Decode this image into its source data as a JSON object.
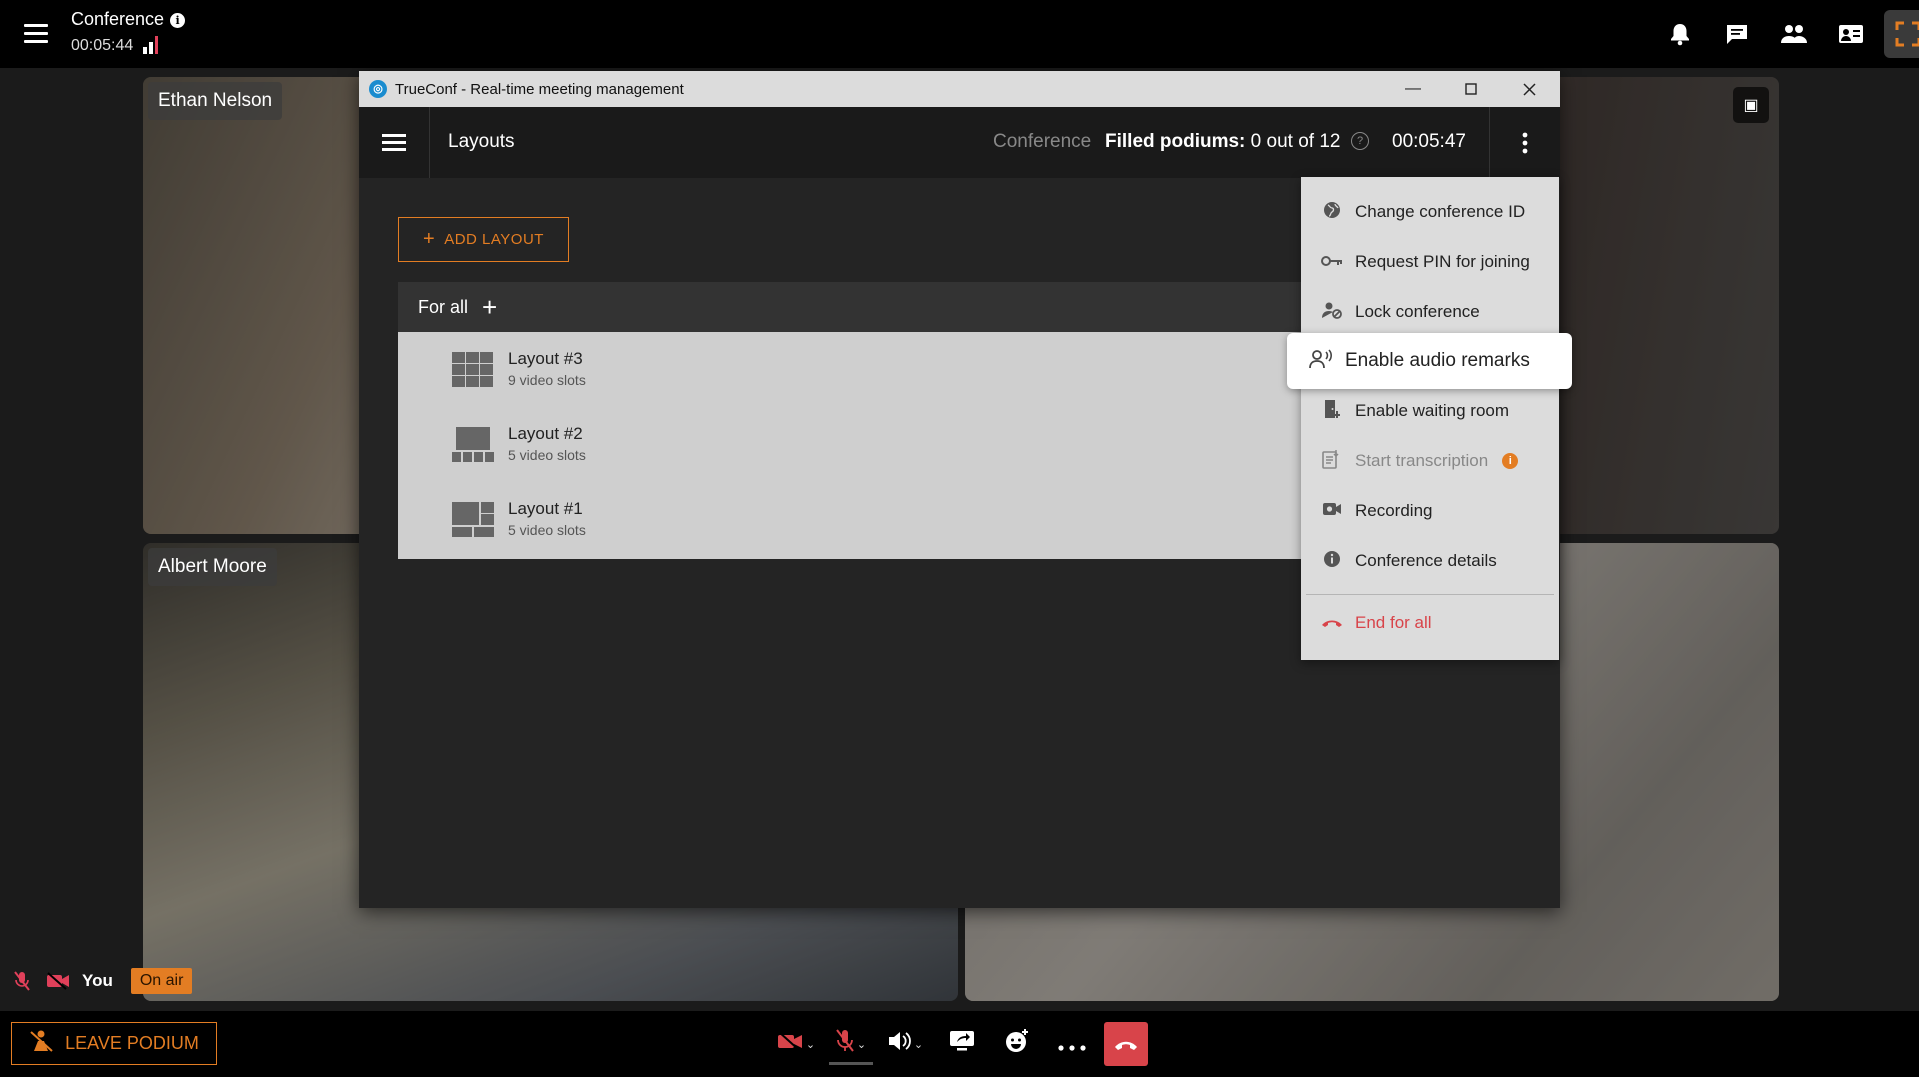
{
  "topbar": {
    "title": "Conference",
    "elapsed": "00:05:44",
    "icons": [
      "bell-icon",
      "chat-icon",
      "participants-icon",
      "slideshow-icon",
      "fullscreen-icon"
    ],
    "accent": "#e37d23"
  },
  "tiles": [
    {
      "name": "Ethan Nelson"
    },
    {
      "name": ""
    },
    {
      "name": "Albert Moore"
    },
    {
      "name": ""
    }
  ],
  "self": {
    "label": "You",
    "status": "On air"
  },
  "bottombar": {
    "leave_label": "LEAVE PODIUM",
    "controls": [
      "camera-off-icon",
      "mic-off-icon",
      "speaker-icon",
      "share-screen-icon",
      "reactions-icon",
      "more-icon",
      "hangup-icon"
    ]
  },
  "dialog": {
    "window_title": "TrueConf - Real-time meeting management",
    "page_title": "Layouts",
    "conference_label": "Conference",
    "podiums_label": "Filled podiums:",
    "podiums_value": "0 out of 12",
    "timer": "00:05:47",
    "add_layout_label": "ADD LAYOUT",
    "group_label": "For all",
    "layouts": [
      {
        "name": "Layout #3",
        "slots": "9 video slots"
      },
      {
        "name": "Layout #2",
        "slots": "5 video slots"
      },
      {
        "name": "Layout #1",
        "slots": "5 video slots"
      }
    ]
  },
  "menu": {
    "items": [
      {
        "label": "Change conference ID",
        "icon": "globe-icon"
      },
      {
        "label": "Request PIN for joining",
        "icon": "key-icon"
      },
      {
        "label": "Lock conference",
        "icon": "lock-user-icon"
      },
      {
        "label": "Enable audio remarks",
        "icon": "speaking-icon"
      },
      {
        "label": "Enable waiting room",
        "icon": "door-icon"
      },
      {
        "label": "Start transcription",
        "icon": "transcription-icon"
      },
      {
        "label": "Recording",
        "icon": "camera-icon"
      },
      {
        "label": "Conference details",
        "icon": "info-icon"
      },
      {
        "label": "End for all",
        "icon": "hangup-icon"
      }
    ],
    "danger_color": "#d8444a"
  }
}
